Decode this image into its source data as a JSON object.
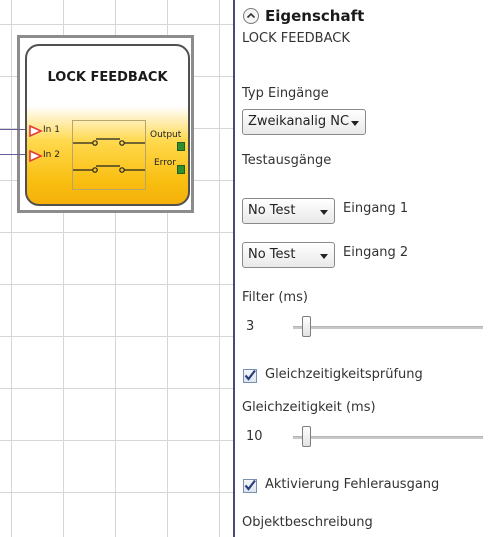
{
  "canvas": {
    "block": {
      "title": "LOCK FEEDBACK",
      "inputs": [
        {
          "label": "In 1"
        },
        {
          "label": "In 2"
        }
      ],
      "outputs": [
        {
          "label": "Output"
        },
        {
          "label": "Error"
        }
      ]
    }
  },
  "panel": {
    "title": "Eigenschaft",
    "collapse_icon": "chevron-up-icon",
    "object_name": "LOCK FEEDBACK",
    "typ_eingaenge": {
      "label": "Typ Eingänge",
      "selected": "Zweikanalig NC"
    },
    "testausgaenge": {
      "label": "Testausgänge",
      "rows": [
        {
          "selected": "No Test",
          "label": "Eingang 1"
        },
        {
          "selected": "No Test",
          "label": "Eingang 2"
        }
      ]
    },
    "filter": {
      "label": "Filter (ms)",
      "value": "3"
    },
    "gleichzeitigkeitspruefung": {
      "label": "Gleichzeitigkeitsprüfung",
      "checked": true
    },
    "gleichzeitigkeit": {
      "label": "Gleichzeitigkeit (ms)",
      "value": "10"
    },
    "aktivierung_fehlerausgang": {
      "label": "Aktivierung Fehlerausgang",
      "checked": true
    },
    "objektbeschreibung": {
      "label": "Objektbeschreibung"
    }
  },
  "colors": {
    "block_gradient_top": "#ffffff",
    "block_gradient_bottom": "#f5b10a",
    "port_arrow": "#e23b3b",
    "output_port": "#2f8f2f",
    "check_mark": "#2a3f7a",
    "panel_border": "#4a4a78"
  }
}
